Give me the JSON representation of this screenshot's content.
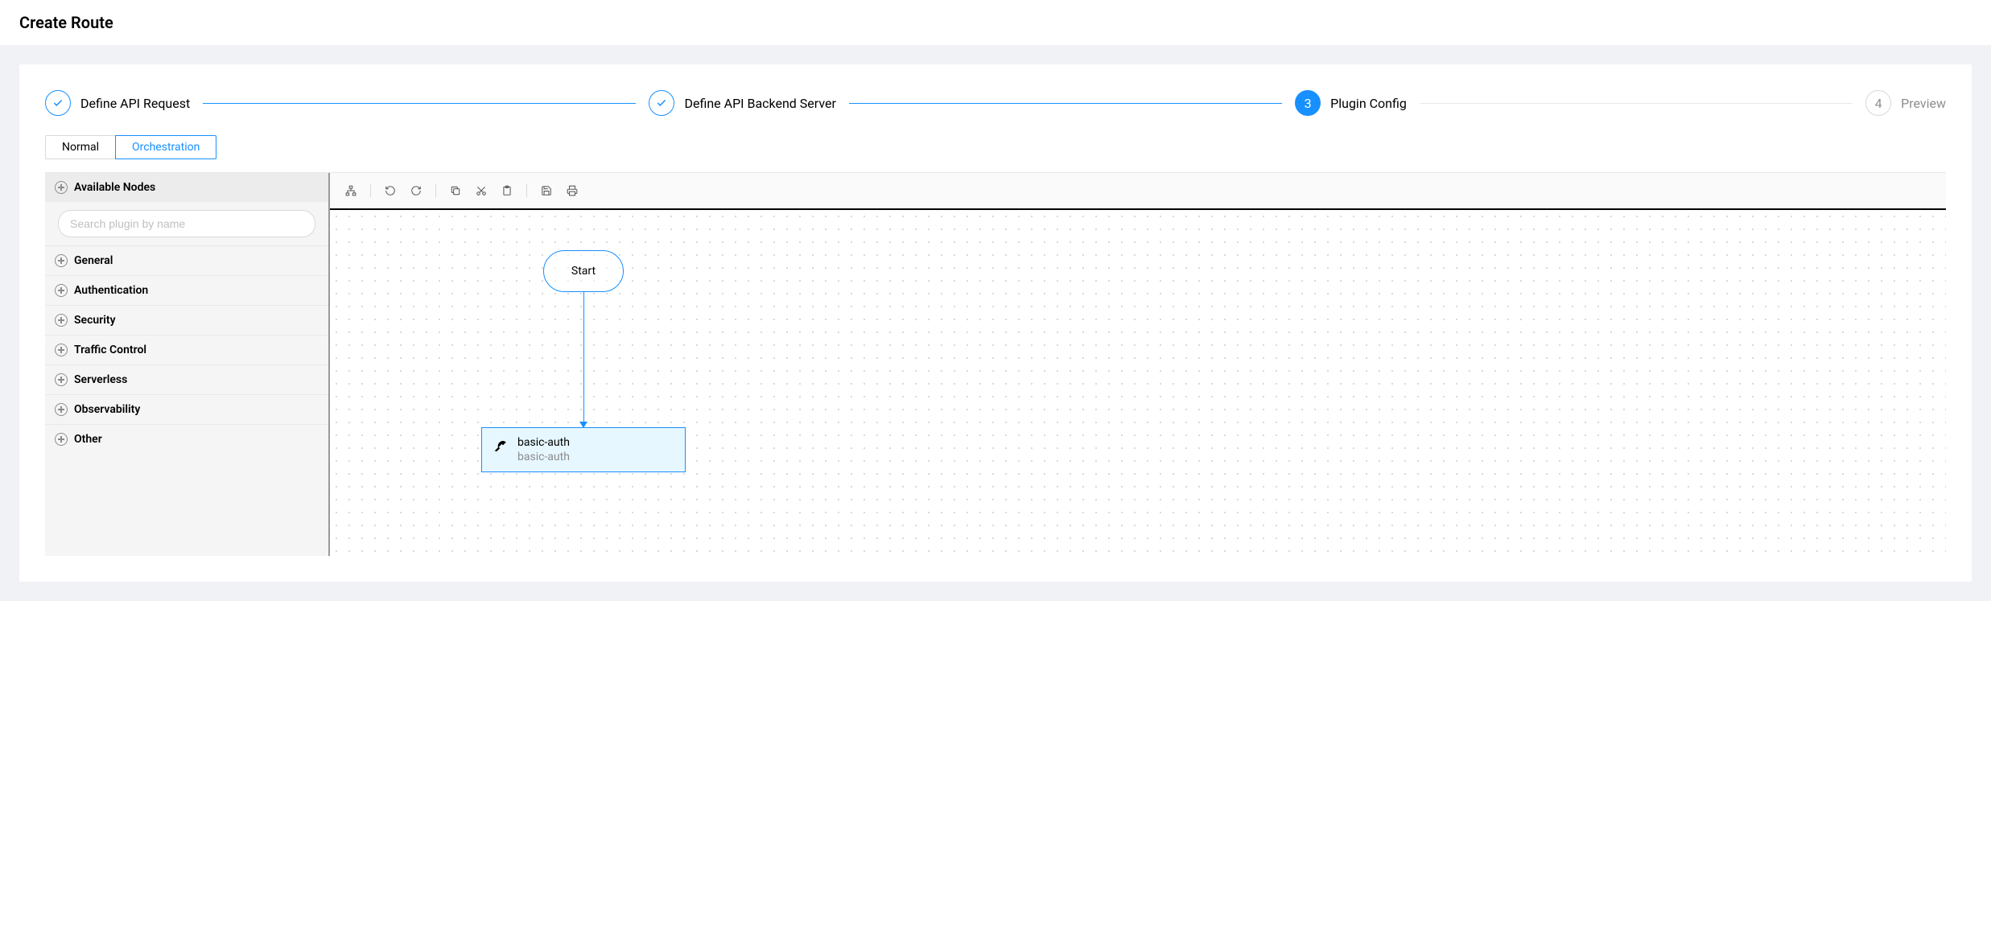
{
  "header": {
    "title": "Create Route"
  },
  "steps": [
    {
      "label": "Define API Request",
      "state": "completed"
    },
    {
      "label": "Define API Backend Server",
      "state": "completed"
    },
    {
      "label": "Plugin Config",
      "state": "active",
      "number": "3"
    },
    {
      "label": "Preview",
      "state": "wait",
      "number": "4"
    }
  ],
  "tabs": {
    "normal": "Normal",
    "orchestration": "Orchestration",
    "active": "orchestration"
  },
  "sidebar": {
    "header": "Available Nodes",
    "search_placeholder": "Search plugin by name",
    "categories": [
      "General",
      "Authentication",
      "Security",
      "Traffic Control",
      "Serverless",
      "Observability",
      "Other"
    ]
  },
  "canvas": {
    "start_label": "Start",
    "plugin_node": {
      "title": "basic-auth",
      "subtitle": "basic-auth"
    }
  }
}
